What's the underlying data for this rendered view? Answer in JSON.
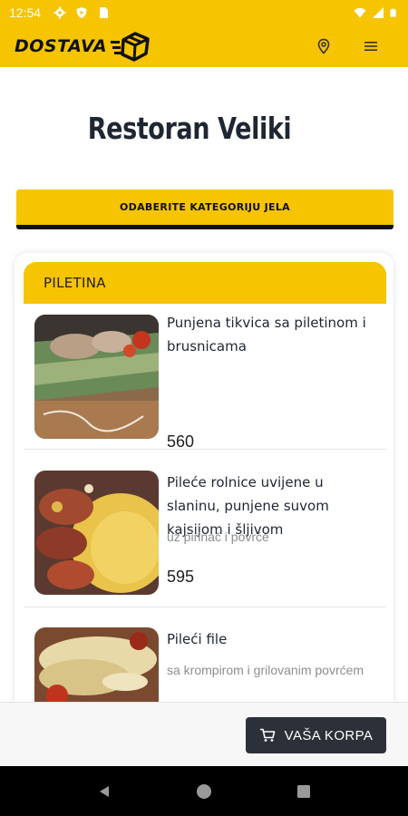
{
  "status_bar": {
    "time": "12:54",
    "icons_left": [
      "gear-icon",
      "shield-icon",
      "sim-card-icon"
    ],
    "icons_right": [
      "wifi-icon",
      "signal-icon",
      "battery-icon"
    ]
  },
  "header": {
    "logo_text": "DOSTAVA",
    "icons": [
      "location-pin-icon",
      "menu-icon"
    ]
  },
  "page": {
    "title": "Restoran Veliki",
    "category_button": "ODABERITE KATEGORIJU JELA"
  },
  "section": {
    "title": "PILETINA",
    "dishes": [
      {
        "name": "Punjena tikvica sa piletinom i brusnicama",
        "description": "",
        "price": "560"
      },
      {
        "name": "Pileće rolnice uvijene u slaninu, punjene suvom kajsijom i šljivom",
        "description": "uz pirinač i povrće",
        "price": "595"
      },
      {
        "name": "Pileći file",
        "description": "sa krompirom i grilovanim povrćem",
        "price": ""
      }
    ]
  },
  "cart": {
    "label": "VAŠA KORPA"
  },
  "nav": [
    "back-icon",
    "home-icon",
    "recents-icon"
  ],
  "colors": {
    "accent": "#f6c400",
    "dark": "#2c3038"
  }
}
